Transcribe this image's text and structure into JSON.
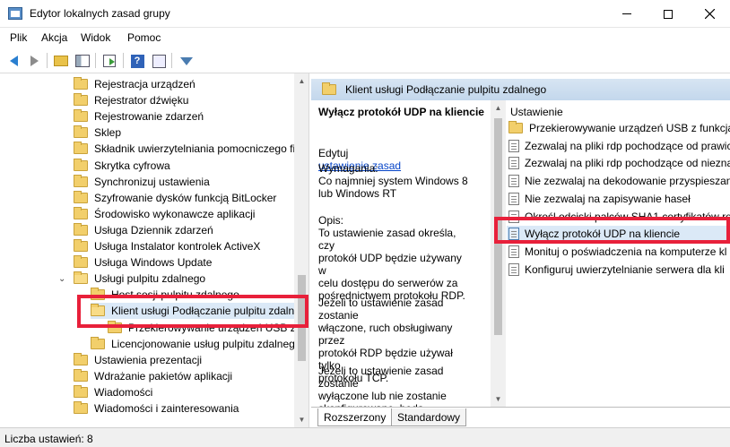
{
  "window": {
    "title": "Edytor lokalnych zasad grupy"
  },
  "menu": [
    {
      "label": "Plik"
    },
    {
      "label": "Akcja"
    },
    {
      "label": "Widok"
    },
    {
      "label": "Pomoc"
    }
  ],
  "toolbar": {
    "help_glyph": "?"
  },
  "tree": {
    "items": [
      {
        "label": "Rejestracja urządzeń",
        "level": 0
      },
      {
        "label": "Rejestrator dźwięku",
        "level": 0
      },
      {
        "label": "Rejestrowanie zdarzeń",
        "level": 0
      },
      {
        "label": "Sklep",
        "level": 0
      },
      {
        "label": "Składnik uwierzytelniania pomocniczego fi",
        "level": 0
      },
      {
        "label": "Skrytka cyfrowa",
        "level": 0
      },
      {
        "label": "Synchronizuj ustawienia",
        "level": 0
      },
      {
        "label": "Szyfrowanie dysków funkcją BitLocker",
        "level": 0
      },
      {
        "label": "Środowisko wykonawcze aplikacji",
        "level": 0
      },
      {
        "label": "Usługa Dziennik zdarzeń",
        "level": 0
      },
      {
        "label": "Usługa Instalator kontrolek ActiveX",
        "level": 0
      },
      {
        "label": "Usługa Windows Update",
        "level": 0
      },
      {
        "label": "Usługi pulpitu zdalnego",
        "level": 0,
        "expanded": true
      },
      {
        "label": "Host sesji pulpitu zdalnego",
        "level": 1
      },
      {
        "label": "Klient usługi Podłączanie pulpitu zdaln",
        "level": 1,
        "expanded": true,
        "selected": true
      },
      {
        "label": "Przekierowywanie urządzeń USB z r",
        "level": 2
      },
      {
        "label": "Licencjonowanie usług pulpitu zdalnego",
        "level": 1
      },
      {
        "label": "Ustawienia prezentacji",
        "level": 0
      },
      {
        "label": "Wdrażanie pakietów aplikacji",
        "level": 0
      },
      {
        "label": "Wiadomości",
        "level": 0
      },
      {
        "label": "Wiadomości i zainteresowania",
        "level": 0
      }
    ]
  },
  "details": {
    "header": "Klient usługi Podłączanie pulpitu zdalnego",
    "title": "Wyłącz protokół UDP na kliencie",
    "edit_prefix": "Edytuj",
    "edit_link": "ustawienie zasad",
    "requirements": "Wymagania:\nCo najmniej system Windows 8\nlub Windows RT",
    "description": "Opis:\nTo ustawienie zasad określa, czy\nprotokół UDP będzie używany w\ncelu dostępu do serwerów za\npośrednictwem protokołu RDP.",
    "enabled_text": "Jeżeli to ustawienie zasad zostanie\nwłączone, ruch obsługiwany przez\nprotokół RDP będzie używał tylko\nprotokołu TCP.",
    "disabled_text": "Jeżeli to ustawienie zasad zostanie\nwyłączone lub nie zostanie\nskonfigurowane, będą\nwykorzystywane protokoły UDP i"
  },
  "settings": {
    "column_header": "Ustawienie",
    "items": [
      {
        "label": "Przekierowywanie urządzeń USB z funkcją R",
        "type": "folder"
      },
      {
        "label": "Zezwalaj na pliki rdp pochodzące od prawic",
        "type": "setting"
      },
      {
        "label": "Zezwalaj na pliki rdp pochodzące od niezna",
        "type": "setting"
      },
      {
        "label": "Nie zezwalaj na dekodowanie przyspieszane",
        "type": "setting"
      },
      {
        "label": "Nie zezwalaj na zapisywanie haseł",
        "type": "setting"
      },
      {
        "label": "Określ odciski palców SHA1 certyfikatów rep",
        "type": "setting"
      },
      {
        "label": "Wyłącz protokół UDP na kliencie",
        "type": "setting",
        "selected": true
      },
      {
        "label": "Monituj o poświadczenia na komputerze kl",
        "type": "setting"
      },
      {
        "label": "Konfiguruj uwierzytelnianie serwera dla kli",
        "type": "setting"
      }
    ]
  },
  "tabs": [
    {
      "label": "Rozszerzony",
      "active": true
    },
    {
      "label": "Standardowy",
      "active": false
    }
  ],
  "status": {
    "text": "Liczba ustawień: 8"
  },
  "colors": {
    "highlight_box": "#e8203a",
    "selection": "#dbe9f7",
    "header_band": "#c3d7ec"
  }
}
